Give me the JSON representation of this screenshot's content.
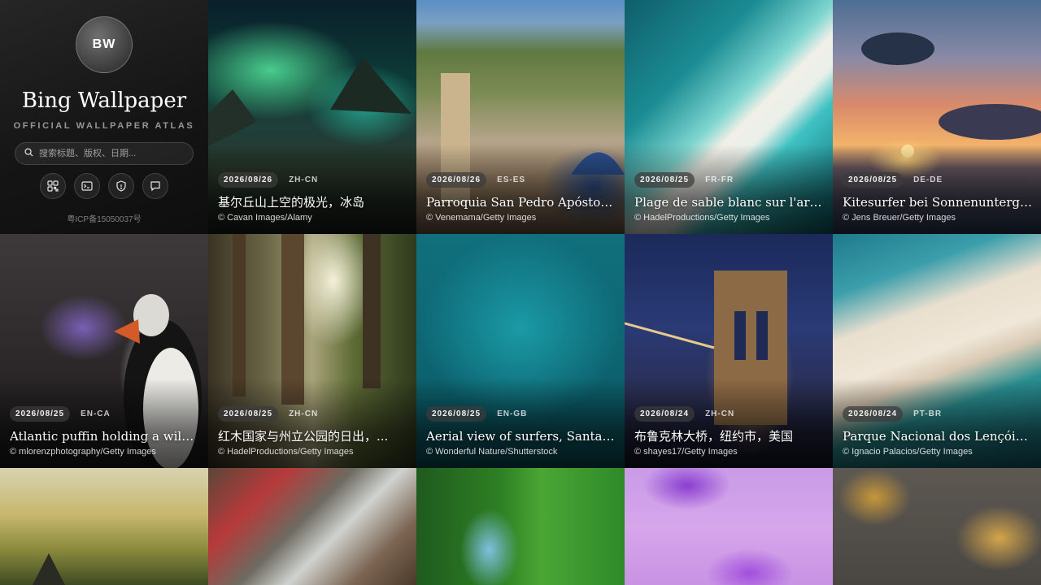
{
  "sidebar": {
    "avatar": "BW",
    "title": "Bing Wallpaper",
    "subtitle": "OFFICIAL WALLPAPER ATLAS",
    "search_placeholder": "搜索标题、版权、日期...",
    "icons": [
      "grid-qr-icon",
      "terminal-icon",
      "shield-icon",
      "chat-icon"
    ],
    "icp": "粤ICP备15050037号"
  },
  "wallpapers": [
    {
      "date": "2026/08/26",
      "market": "ZH-CN",
      "title": "基尔丘山上空的极光，冰岛",
      "copyright": "© Cavan Images/Alamy"
    },
    {
      "date": "2026/08/26",
      "market": "ES-ES",
      "title": "Parroquia San Pedro Apóstol, Buñ...",
      "copyright": "© Venemama/Getty Images"
    },
    {
      "date": "2026/08/25",
      "market": "FR-FR",
      "title": "Plage de sable blanc sur l'archipel ...",
      "copyright": "© HadelProductions/Getty Images"
    },
    {
      "date": "2026/08/25",
      "market": "DE-DE",
      "title": "Kitesurfer bei Sonnenuntergang in ...",
      "copyright": "© Jens Breuer/Getty Images"
    },
    {
      "date": "2026/08/25",
      "market": "EN-CA",
      "title": "Atlantic puffin holding a wild iris i...",
      "copyright": "© mlorenzphotography/Getty Images"
    },
    {
      "date": "2026/08/25",
      "market": "ZH-CN",
      "title": "红木国家与州立公园的日出，...",
      "copyright": "© HadelProductions/Getty Images"
    },
    {
      "date": "2026/08/25",
      "market": "EN-GB",
      "title": "Aerial view of surfers, Santa Catar...",
      "copyright": "© Wonderful Nature/Shutterstock"
    },
    {
      "date": "2026/08/24",
      "market": "ZH-CN",
      "title": "布鲁克林大桥，纽约市，美国",
      "copyright": "© shayes17/Getty Images"
    },
    {
      "date": "2026/08/24",
      "market": "PT-BR",
      "title": "Parque Nacional dos Lençóis Mara...",
      "copyright": "© Ignacio Palacios/Getty Images"
    }
  ]
}
